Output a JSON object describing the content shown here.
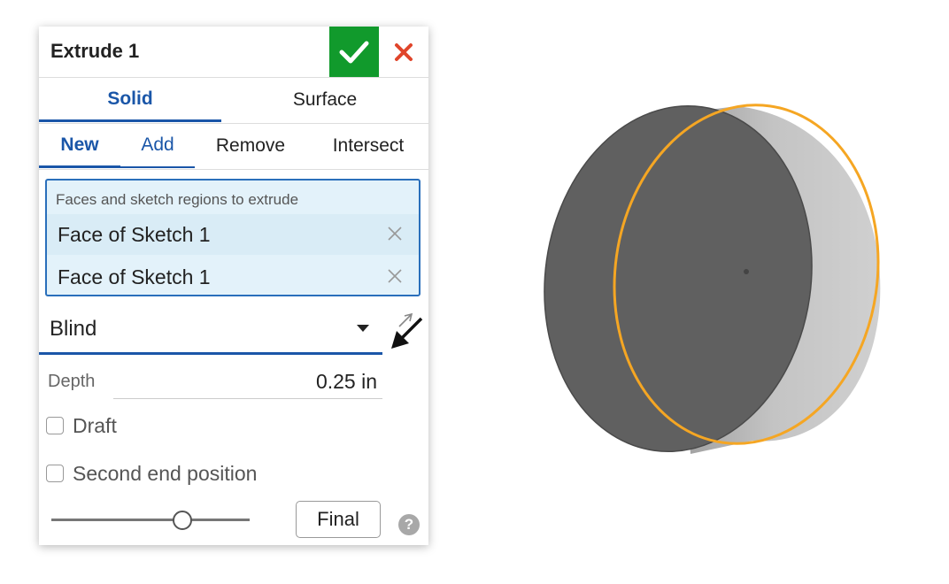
{
  "dialog": {
    "title": "Extrude 1",
    "ok_icon": "checkmark-icon",
    "cancel_icon": "close-x-icon"
  },
  "body_type_tabs": {
    "items": [
      "Solid",
      "Surface"
    ],
    "active": "Solid"
  },
  "operation_tabs": {
    "items": [
      "New",
      "Add",
      "Remove",
      "Intersect"
    ],
    "active": "New"
  },
  "selection": {
    "label": "Faces and sketch regions to extrude",
    "items": [
      "Face of Sketch 1",
      "Face of Sketch 1"
    ]
  },
  "end_type": {
    "value": "Blind"
  },
  "depth": {
    "label": "Depth",
    "value": "0.25 in"
  },
  "options": {
    "draft_label": "Draft",
    "draft_checked": false,
    "second_end_label": "Second end position",
    "second_end_checked": false
  },
  "footer": {
    "slider_position": 0.66,
    "final_label": "Final",
    "help_label": "?"
  },
  "colors": {
    "accent_blue": "#1a56a8",
    "ok_green": "#119a2c",
    "cancel_red": "#e0452b",
    "selection_bg": "#e3f2fa",
    "highlight_orange": "#f5a623"
  }
}
